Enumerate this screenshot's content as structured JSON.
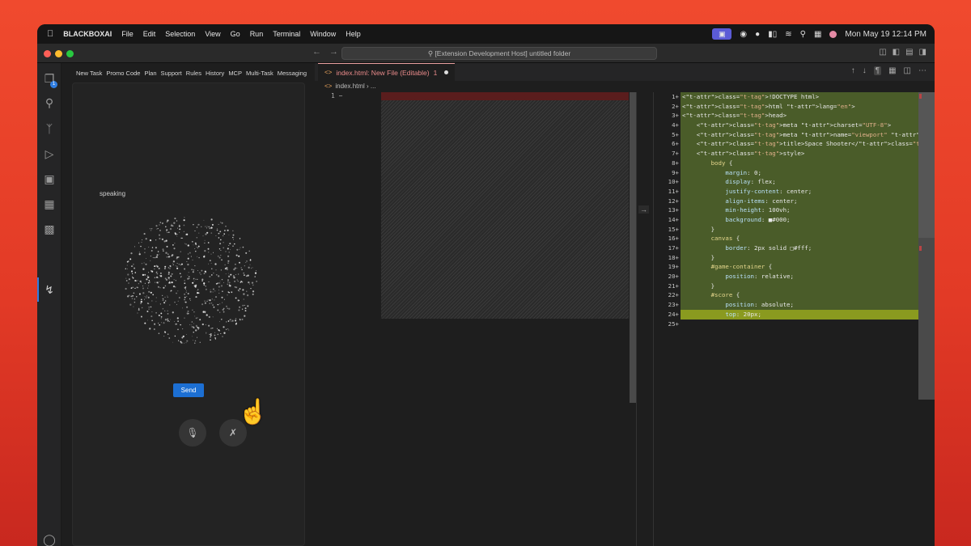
{
  "menubar": {
    "app": "BLACKBOXAI",
    "items": [
      "File",
      "Edit",
      "Selection",
      "View",
      "Go",
      "Run",
      "Terminal",
      "Window",
      "Help"
    ],
    "clock": "Mon May 19  12:14 PM"
  },
  "titlebar": {
    "command_center": "[Extension Development Host] untitled folder"
  },
  "activity": {
    "badge": "1"
  },
  "sidebar": {
    "tabs": [
      "New Task",
      "Promo Code",
      "Plan",
      "Support",
      "Rules",
      "History",
      "MCP",
      "Multi-Task",
      "Messaging"
    ],
    "status_text": "speaking",
    "send_label": "Send"
  },
  "editor": {
    "tab_label": "index.html: New File (Editable)",
    "tab_count": "1",
    "breadcrumb_file": "index.html",
    "breadcrumb_rest": "› ...",
    "left_line_number": "1",
    "left_line_marker": "−"
  },
  "colors": {
    "added_line": "#4a5c29",
    "highlight_line": "#8a9a1f",
    "removed_line": "#5a1d1d",
    "accent": "#1c6fd3"
  },
  "code_lines": [
    {
      "num": "1+",
      "text": "<!DOCTYPE html>"
    },
    {
      "num": "2+",
      "text": "<html lang=\"en\">"
    },
    {
      "num": "3+",
      "text": "<head>"
    },
    {
      "num": "4+",
      "text": "    <meta charset=\"UTF-8\">"
    },
    {
      "num": "5+",
      "text": "    <meta name=\"viewport\" content=\"width=device-width, initial-scale=1.0\">"
    },
    {
      "num": "6+",
      "text": "    <title>Space Shooter</title>"
    },
    {
      "num": "7+",
      "text": "    <style>"
    },
    {
      "num": "8+",
      "text": "        body {"
    },
    {
      "num": "9+",
      "text": "            margin: 0;"
    },
    {
      "num": "10+",
      "text": "            display: flex;"
    },
    {
      "num": "11+",
      "text": "            justify-content: center;"
    },
    {
      "num": "12+",
      "text": "            align-items: center;"
    },
    {
      "num": "13+",
      "text": "            min-height: 100vh;"
    },
    {
      "num": "14+",
      "text": "            background: ■#000;"
    },
    {
      "num": "15+",
      "text": "        }"
    },
    {
      "num": "16+",
      "text": "        canvas {"
    },
    {
      "num": "17+",
      "text": "            border: 2px solid □#fff;"
    },
    {
      "num": "18+",
      "text": "        }"
    },
    {
      "num": "19+",
      "text": "        #game-container {"
    },
    {
      "num": "20+",
      "text": "            position: relative;"
    },
    {
      "num": "21+",
      "text": "        }"
    },
    {
      "num": "22+",
      "text": "        #score {"
    },
    {
      "num": "23+",
      "text": "            position: absolute;"
    },
    {
      "num": "24+",
      "text": "            top: 20px;"
    },
    {
      "num": "25+",
      "text": ""
    }
  ]
}
